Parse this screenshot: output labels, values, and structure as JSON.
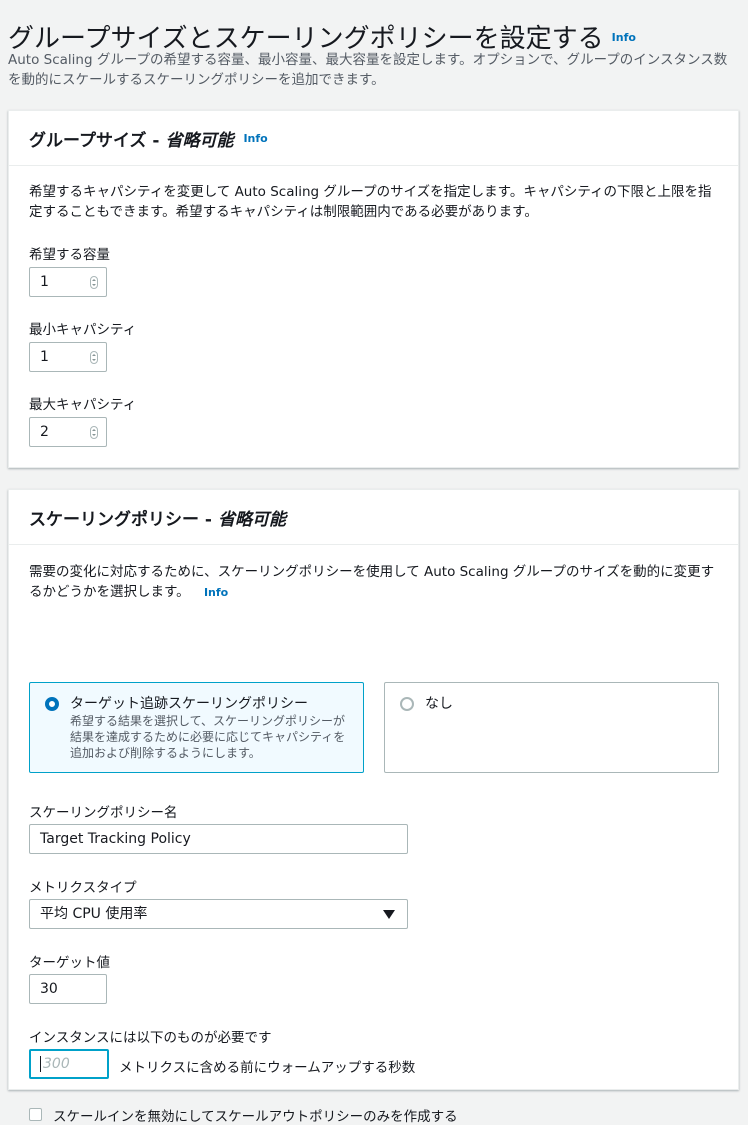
{
  "page": {
    "title": "グループサイズとスケーリングポリシーを設定する",
    "info": "Info",
    "description": "Auto Scaling グループの希望する容量、最小容量、最大容量を設定します。オプションで、グループのインスタンス数を動的にスケールするスケーリングポリシーを追加できます。"
  },
  "group_size": {
    "title": "グループサイズ -",
    "optional": "省略可能",
    "info": "Info",
    "description": "希望するキャパシティを変更して Auto Scaling グループのサイズを指定します。キャパシティの下限と上限を指定することもできます。希望するキャパシティは制限範囲内である必要があります。",
    "desired": {
      "label": "希望する容量",
      "value": "1"
    },
    "min": {
      "label": "最小キャパシティ",
      "value": "1"
    },
    "max": {
      "label": "最大キャパシティ",
      "value": "2"
    }
  },
  "scaling": {
    "title": "スケーリングポリシー -",
    "optional": "省略可能",
    "info": "Info",
    "description": "需要の変化に対応するために、スケーリングポリシーを使用して Auto Scaling グループのサイズを動的に変更するかどうかを選択します。",
    "option_target": {
      "title": "ターゲット追跡スケーリングポリシー",
      "description": "希望する結果を選択して、スケーリングポリシーが結果を達成するために必要に応じてキャパシティを追加および削除するようにします。",
      "selected": true
    },
    "option_none": {
      "title": "なし",
      "selected": false
    },
    "policy_name": {
      "label": "スケーリングポリシー名",
      "value": "Target Tracking Policy"
    },
    "metric_type": {
      "label": "メトリクスタイプ",
      "value": "平均 CPU 使用率"
    },
    "target_value": {
      "label": "ターゲット値",
      "value": "30"
    },
    "warmup": {
      "label": "インスタンスには以下のものが必要です",
      "placeholder": "300",
      "suffix": "メトリクスに含める前にウォームアップする秒数"
    },
    "disable_scale_in": {
      "label": "スケールインを無効にしてスケールアウトポリシーのみを作成する",
      "checked": false
    }
  }
}
